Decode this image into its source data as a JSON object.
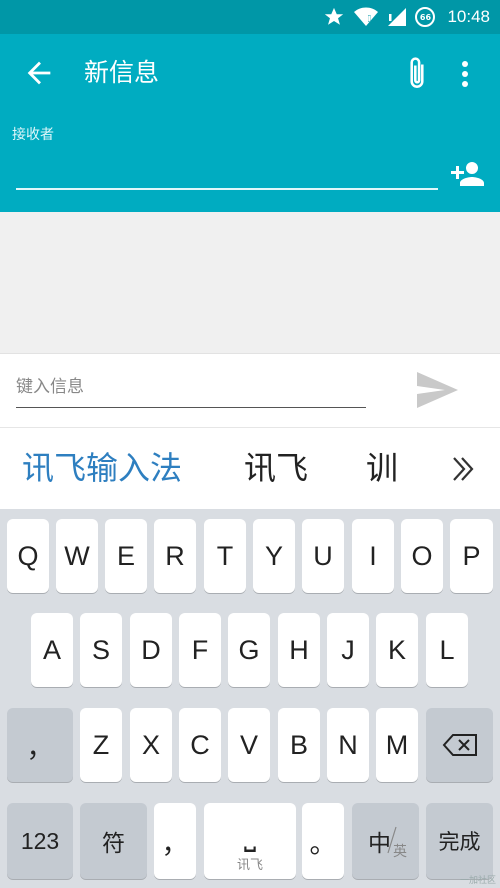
{
  "status_bar": {
    "time": "10:48",
    "battery_level": "66",
    "icons": [
      "star-icon",
      "wifi-icon",
      "signal-icon",
      "battery-icon"
    ]
  },
  "app_bar": {
    "title": "新信息",
    "recipient_label": "接收者",
    "recipient_value": "",
    "icons": [
      "back-arrow-icon",
      "paperclip-icon",
      "more-vert-icon",
      "add-person-icon"
    ],
    "color": "#00acc1"
  },
  "compose": {
    "placeholder": "键入信息",
    "value": ""
  },
  "candidates": {
    "brand": "讯飞输入法",
    "items": [
      "讯飞",
      "训"
    ],
    "more_icon": "double-chevron-right-icon"
  },
  "keyboard": {
    "row1": [
      "Q",
      "W",
      "E",
      "R",
      "T",
      "Y",
      "U",
      "I",
      "O",
      "P"
    ],
    "row2": [
      "A",
      "S",
      "D",
      "F",
      "G",
      "H",
      "J",
      "K",
      "L"
    ],
    "row3": {
      "comma": "，",
      "letters": [
        "Z",
        "X",
        "C",
        "V",
        "B",
        "N",
        "M"
      ],
      "backspace_icon": "backspace-icon"
    },
    "row4": {
      "numbers": "123",
      "symbols": "符",
      "comma": "，",
      "space_glyph": "⎵",
      "space_sub": "讯飞",
      "period": "。",
      "lang_main": "中",
      "lang_sub": "英",
      "done": "完成"
    }
  },
  "watermark": "一加社区"
}
